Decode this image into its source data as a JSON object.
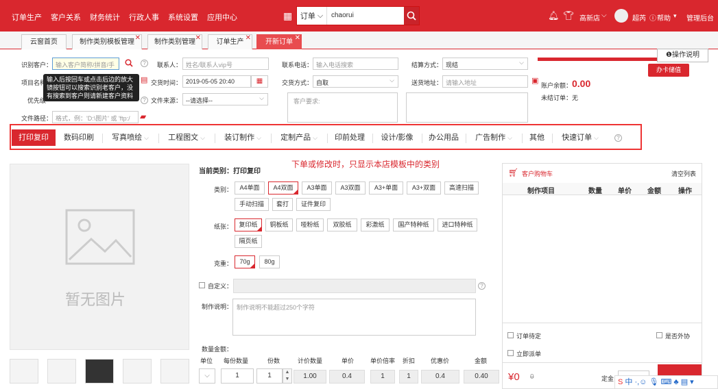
{
  "nav": {
    "items": [
      "订单生产",
      "客户关系",
      "财务统计",
      "行政人事",
      "系统设置",
      "应用中心"
    ],
    "search_type": "订单",
    "search_value": "chaorui",
    "shop": "高新店",
    "user": "超芮",
    "help": "帮助",
    "admin": "管理后台"
  },
  "tabs": [
    "云窗首页",
    "制作类别模板管理",
    "制作类别管理",
    "订单生产",
    "开新订单"
  ],
  "form": {
    "customer_label": "识别客户：",
    "customer_placeholder": "输入客户简称/拼音/手",
    "tooltip": "输入后按回车或点击后边的放大镜按钮可以搜索识别老客户，没有搜索到客户则请新建客户资料",
    "project_label": "项目名称",
    "priority_label": "优先级",
    "contact_label": "联系人：",
    "contact_placeholder": "姓名/联系人vip号",
    "phone_label": "联系电话：",
    "phone_placeholder": "输入电话搜索",
    "settle_label": "结算方式：",
    "settle_value": "现结",
    "time_label": "交货时间：",
    "time_value": "2019-05-05 20:40",
    "delivery_label": "交货方式：",
    "delivery_value": "自取",
    "address_label": "送货地址：",
    "address_placeholder": "请输入地址",
    "source_label": "文件来源：",
    "source_value": "--请选择--",
    "requirement_placeholder": "客户要求:",
    "path_label": "文件路径：",
    "path_placeholder": "格式，例：'D:\\图片' 或 'ftp:/",
    "ops_btn": "操作说明",
    "card_btn": "办卡储值",
    "balance_label": "账户余额：",
    "balance_value": "0.00",
    "unsettled": "未结订单：无"
  },
  "categories": [
    "打印复印",
    "数码印刷",
    "写真喷绘",
    "工程图文",
    "装订制作",
    "定制产品",
    "印前处理",
    "设计/影像",
    "办公用品",
    "广告制作",
    "其他",
    "快速订单"
  ],
  "main": {
    "no_image": "暂无图片",
    "current_category": "当前类别：打印复印",
    "notice": "下单或修改时，只显示本店模板中的类别",
    "type_label": "类别：",
    "types": [
      "A4单面",
      "A4双面",
      "A3单面",
      "A3双面",
      "A3+单面",
      "A3+双面",
      "高速扫描",
      "手动扫描",
      "套打",
      "证件复印"
    ],
    "paper_label": "纸张：",
    "papers": [
      "复印纸",
      "铜板纸",
      "哑粉纸",
      "双胶纸",
      "彩激纸",
      "国产特种纸",
      "进口特种纸",
      "隔页纸"
    ],
    "weight_label": "克重：",
    "weights": [
      "70g",
      "80g"
    ],
    "custom_label": "自定义：",
    "desc_label": "制作说明：",
    "desc_placeholder": "制作说明不能超过250个字符",
    "amount_label": "数量金额：",
    "cols": [
      "单位",
      "每份数量",
      "份数",
      "计价数量",
      "单价",
      "单价倍率",
      "折扣",
      "优惠价",
      "金额"
    ],
    "vals": [
      "1",
      "1",
      "1.00",
      "0.4",
      "1",
      "1",
      "0.4",
      "0.40"
    ]
  },
  "cart": {
    "title": "客户购物车",
    "clear": "清空列表",
    "cols": [
      "制作项目",
      "数量",
      "单价",
      "金额",
      "操作"
    ],
    "pending": "订单待定",
    "dispatch": "立即派单",
    "outsource": "是否外协",
    "total": "¥0",
    "total2": "0",
    "deposit_label": "定金"
  }
}
